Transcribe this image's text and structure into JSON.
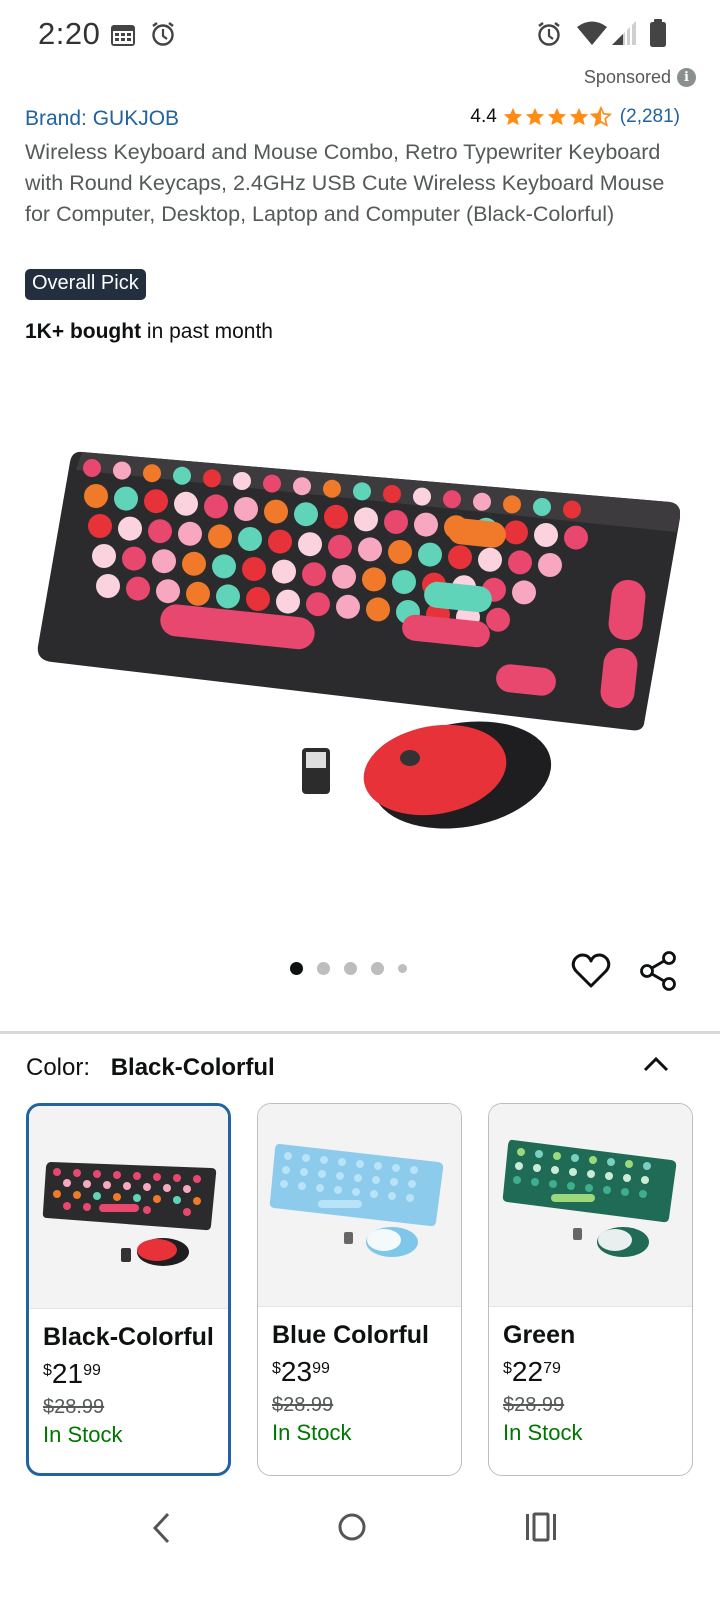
{
  "status_bar": {
    "time": "2:20"
  },
  "ad": {
    "sponsored_label": "Sponsored"
  },
  "product": {
    "brand": "Brand: GUKJOB",
    "rating": "4.4",
    "rating_count": "(2,281)",
    "title": "Wireless Keyboard and Mouse Combo, Retro Typewriter Keyboard with Round Keycaps, 2.4GHz USB Cute Wireless Keyboard Mouse for Computer, Desktop, Laptop and Computer (Black-Colorful)",
    "badge": "Overall Pick",
    "bought_bold": "1K+ bought",
    "bought_rest": " in past month",
    "image_dots": 5,
    "active_image": 1
  },
  "color_selector": {
    "label": "Color:",
    "selected": "Black-Colorful"
  },
  "variants": [
    {
      "name": "Black-Colorful",
      "currency": "$",
      "price_whole": "21",
      "price_fraction": "99",
      "was_price": "$28.99",
      "stock": "In Stock",
      "selected": true
    },
    {
      "name": "Blue Colorful",
      "currency": "$",
      "price_whole": "23",
      "price_fraction": "99",
      "was_price": "$28.99",
      "stock": "In Stock",
      "selected": false
    },
    {
      "name": "Green",
      "currency": "$",
      "price_whole": "22",
      "price_fraction": "79",
      "was_price": "$28.99",
      "stock": "In Stock",
      "selected": false
    }
  ],
  "colors": {
    "link": "#2162a1",
    "star": "#ff8c14",
    "badge_bg": "#232f3e",
    "in_stock": "#007600",
    "selected_border": "#2162a1"
  }
}
